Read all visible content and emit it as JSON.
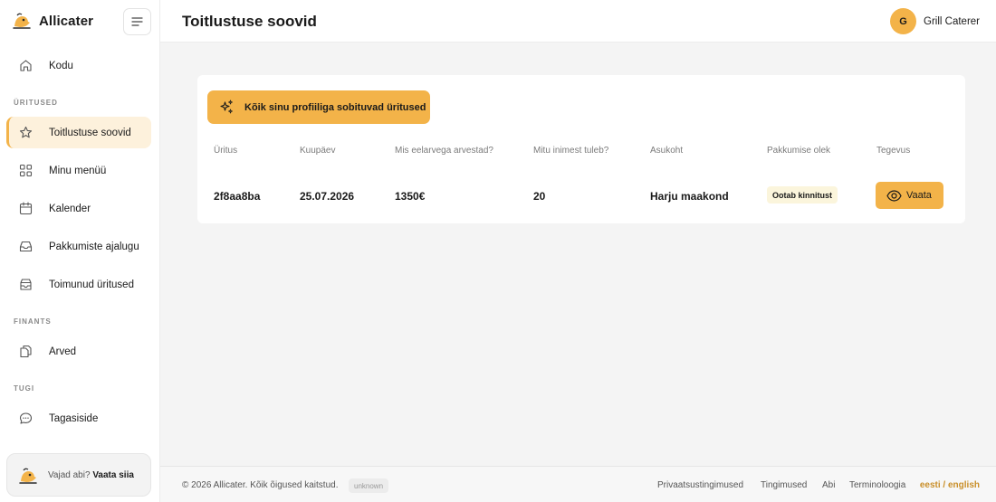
{
  "app": {
    "name": "Allicater"
  },
  "sidebar": {
    "home": "Kodu",
    "sections": {
      "events": "ÜRITUSED",
      "finance": "FINANTS",
      "support": "TUGI"
    },
    "items": {
      "catering_requests": "Toitlustuse soovid",
      "my_menu": "Minu menüü",
      "calendar": "Kalender",
      "offer_history": "Pakkumiste ajalugu",
      "past_events": "Toimunud üritused",
      "invoices": "Arved",
      "feedback": "Tagasiside"
    },
    "help": {
      "text": "Vajad abi?",
      "link": "Vaata siia"
    }
  },
  "header": {
    "title": "Toitlustuse soovid",
    "user": {
      "initial": "G",
      "name": "Grill Caterer"
    }
  },
  "main": {
    "filter_button": "Kõik sinu profiiliga sobituvad üritused",
    "table": {
      "columns": {
        "event": "Üritus",
        "date": "Kuupäev",
        "budget": "Mis eelarvega arvestad?",
        "guests": "Mitu inimest tuleb?",
        "location": "Asukoht",
        "offer_status": "Pakkumise olek",
        "action": "Tegevus"
      },
      "rows": [
        {
          "event": "2f8aa8ba",
          "date": "25.07.2026",
          "budget": "1350€",
          "guests": "20",
          "location": "Harju maakond",
          "offer_status": "Ootab kinnitust",
          "action": "Vaata"
        }
      ]
    }
  },
  "footer": {
    "copyright": "© 2026 Allicater. Kõik õigused kaitstud.",
    "version": "unknown",
    "links": {
      "privacy": "Privaatsustingimused",
      "terms": "Tingimused",
      "help": "Abi",
      "terminology": "Terminoloogia"
    },
    "language": "eesti / english"
  },
  "colors": {
    "accent": "#f3b349",
    "active_bg": "#fdf1dc",
    "badge_bg": "#fbf5dc",
    "language_link": "#c98f2a"
  }
}
